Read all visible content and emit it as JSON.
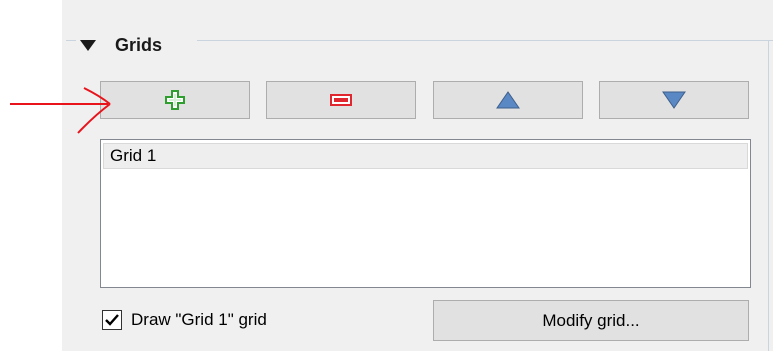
{
  "group": {
    "title": "Grids"
  },
  "toolbar": {
    "add_icon": "plus-icon",
    "remove_icon": "minus-icon",
    "up_icon": "triangle-up-icon",
    "down_icon": "triangle-down-icon",
    "add_color": "#2e9e2e",
    "remove_color": "#e0262f",
    "arrow_color": "#5a88c4"
  },
  "grid_list": {
    "items": [
      {
        "label": "Grid 1"
      }
    ]
  },
  "draw_grid": {
    "checked": true,
    "label": "Draw \"Grid 1\" grid"
  },
  "modify_button": {
    "label": "Modify grid..."
  },
  "annotation": {
    "type": "red-arrow",
    "color": "#e8131b"
  }
}
